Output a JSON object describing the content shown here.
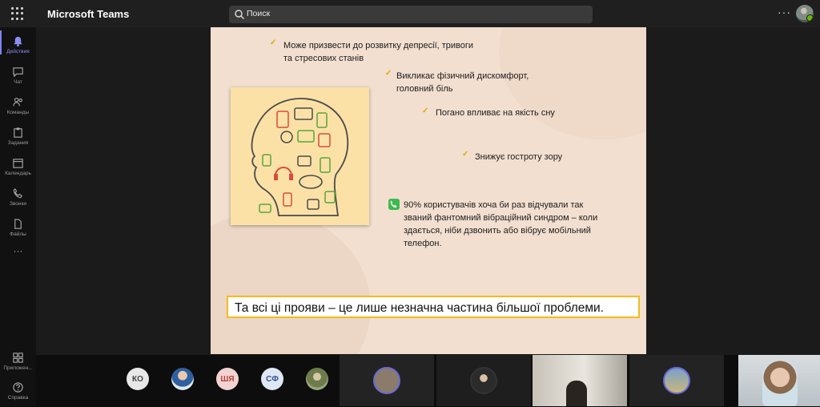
{
  "app": {
    "title": "Microsoft Teams"
  },
  "search": {
    "placeholder": "Поиск"
  },
  "header": {
    "more_label": "···"
  },
  "rail": {
    "items": [
      {
        "label": "Действия",
        "icon": "bell-icon"
      },
      {
        "label": "Чат",
        "icon": "chat-icon"
      },
      {
        "label": "Команды",
        "icon": "teams-icon"
      },
      {
        "label": "Задания",
        "icon": "assignments-icon"
      },
      {
        "label": "Календарь",
        "icon": "calendar-icon"
      },
      {
        "label": "Звонки",
        "icon": "phone-icon"
      },
      {
        "label": "Файлы",
        "icon": "file-icon"
      }
    ],
    "more_label": "···",
    "bottom_items": [
      {
        "label": "Приложен...",
        "icon": "apps-icon"
      },
      {
        "label": "Справка",
        "icon": "help-icon"
      }
    ]
  },
  "slide": {
    "bullets": [
      {
        "line1": "Може призвести до розвитку депресії, тривоги",
        "line2": "та стресових станів"
      },
      {
        "line1": "Викликає фізичний дискомфорт,",
        "line2": "головний біль"
      },
      {
        "line1": "Погано впливає на якість сну",
        "line2": ""
      },
      {
        "line1": "Знижує гостроту зору",
        "line2": ""
      }
    ],
    "phantom": {
      "line1": "90% користувачів хоча би раз відчували так",
      "line2": "званий фантомний вібраційний синдром – коли",
      "line3": "здається, ніби дзвонить або вібрує мобільний",
      "line4": "телефон."
    },
    "callout": "Та всі ці прояви – це лише незначна частина більшої проблеми.",
    "illustration": "head-with-gadgets-illustration",
    "accent_color": "#e2a700",
    "callout_border": "#f2bc1f"
  },
  "participants": {
    "avatars": [
      {
        "initials": "КО",
        "bg": "#e8e8e8",
        "fg": "#444"
      },
      {
        "initials": "",
        "bg": "#8aa0b8",
        "fg": "#fff",
        "photo": true
      },
      {
        "initials": "ШЯ",
        "bg": "#f3d2d2",
        "fg": "#b4453d"
      },
      {
        "initials": "СФ",
        "bg": "#dfe7f4",
        "fg": "#2c4f8f"
      },
      {
        "initials": "",
        "bg": "#7a8a5a",
        "fg": "#fff",
        "photo": true
      }
    ]
  }
}
